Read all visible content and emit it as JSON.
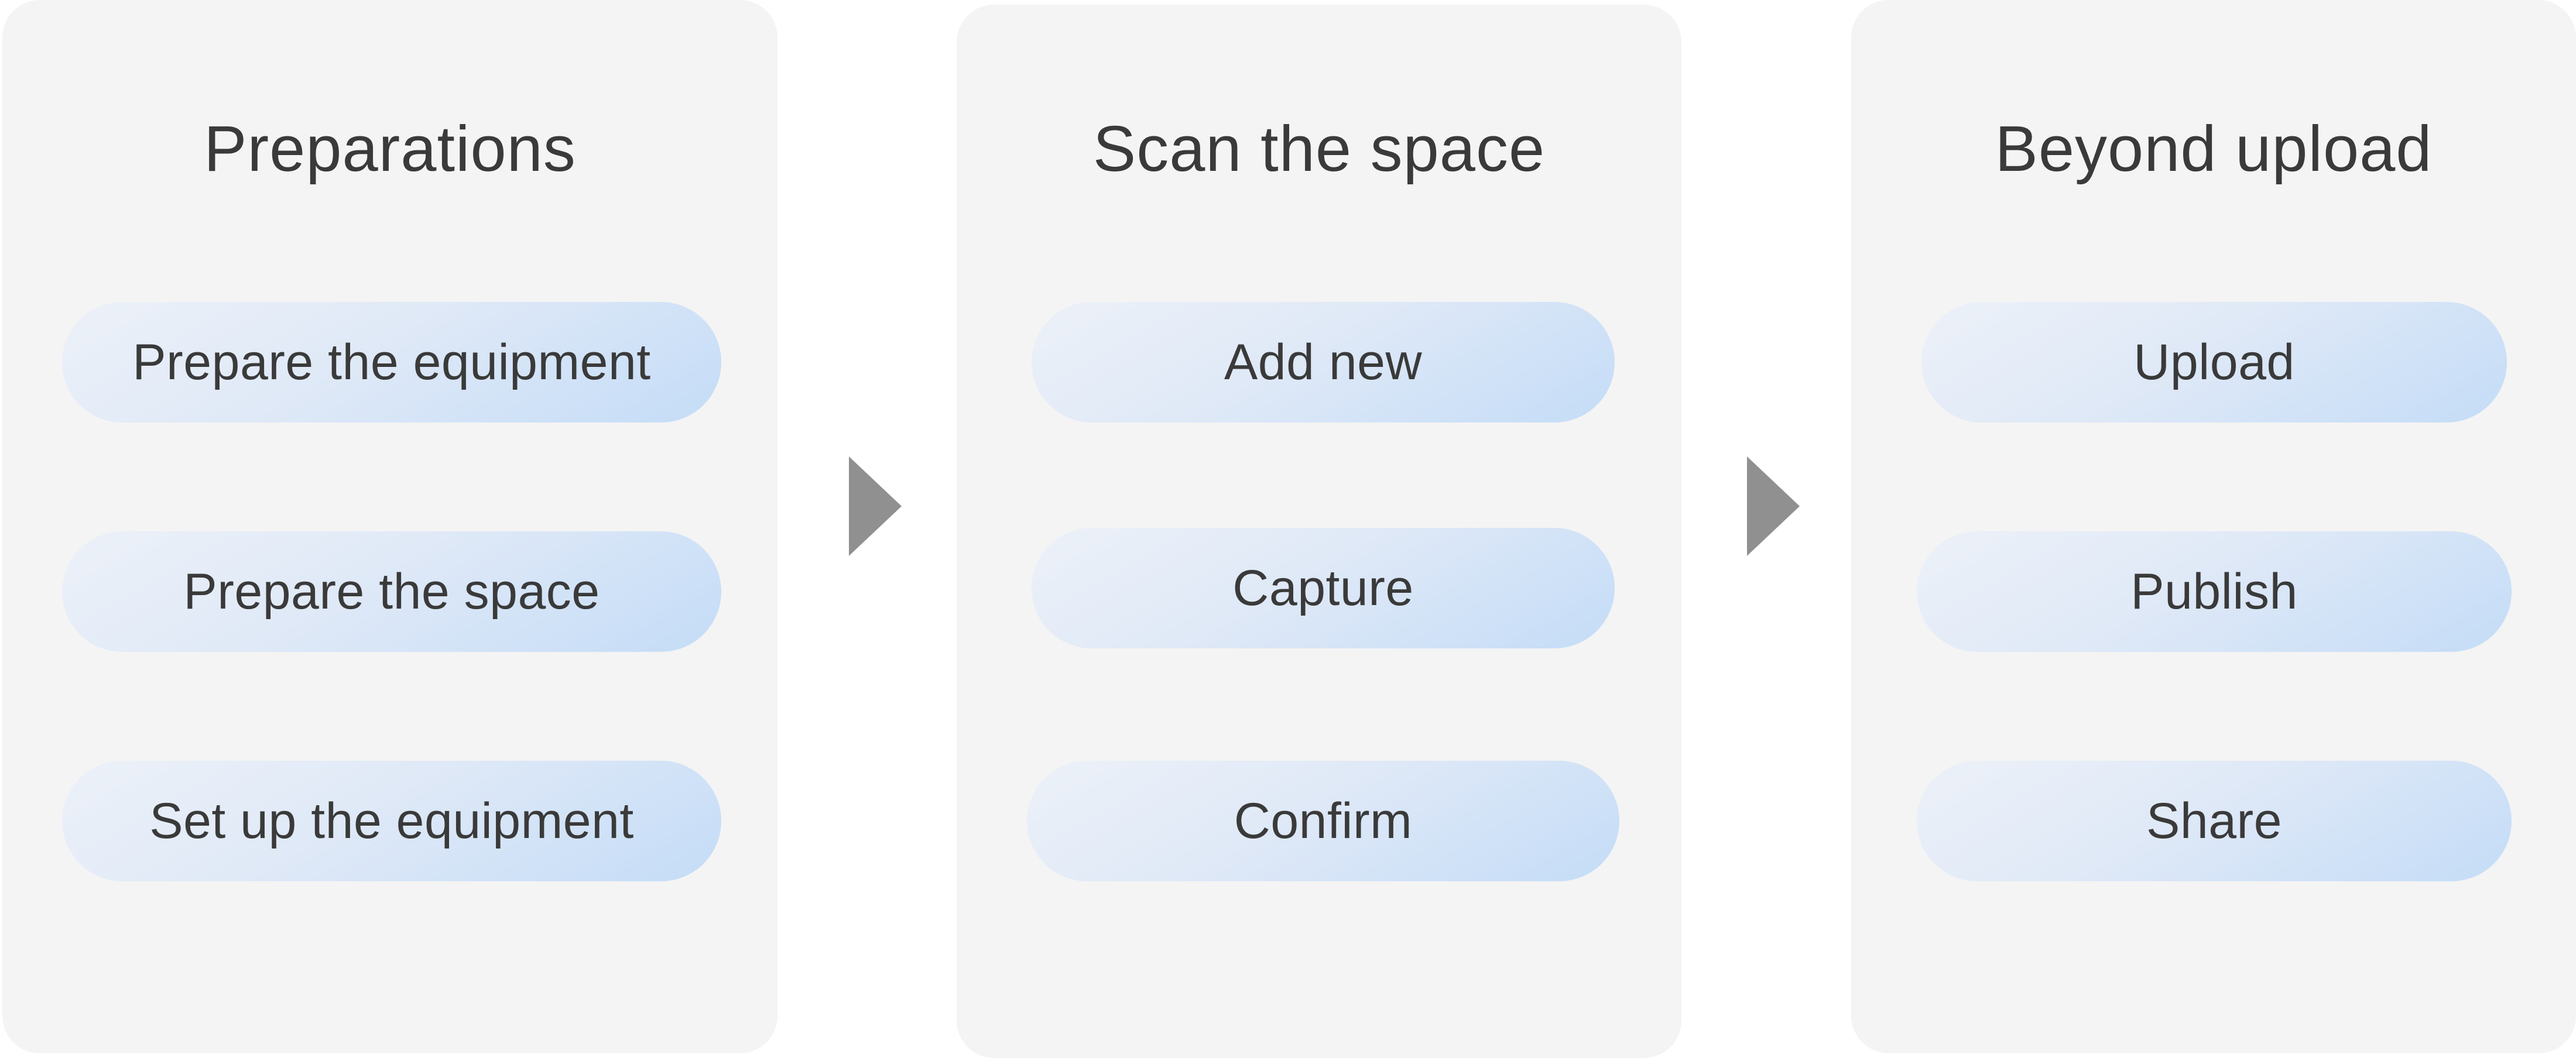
{
  "colors": {
    "panel_background": "#f4f4f4",
    "pill_gradient_start": "#edf1f8",
    "pill_gradient_end": "#c4dcf7",
    "arrow": "#909090",
    "text": "#3a3a3a"
  },
  "arrows": [
    "triangle-arrow-icon",
    "triangle-arrow-icon"
  ],
  "stages": [
    {
      "title": "Preparations",
      "steps": [
        "Prepare the equipment",
        "Prepare the space",
        "Set up the equipment"
      ]
    },
    {
      "title": "Scan the space",
      "steps": [
        "Add new",
        "Capture",
        "Confirm"
      ]
    },
    {
      "title": "Beyond upload",
      "steps": [
        "Upload",
        "Publish",
        "Share"
      ]
    }
  ]
}
